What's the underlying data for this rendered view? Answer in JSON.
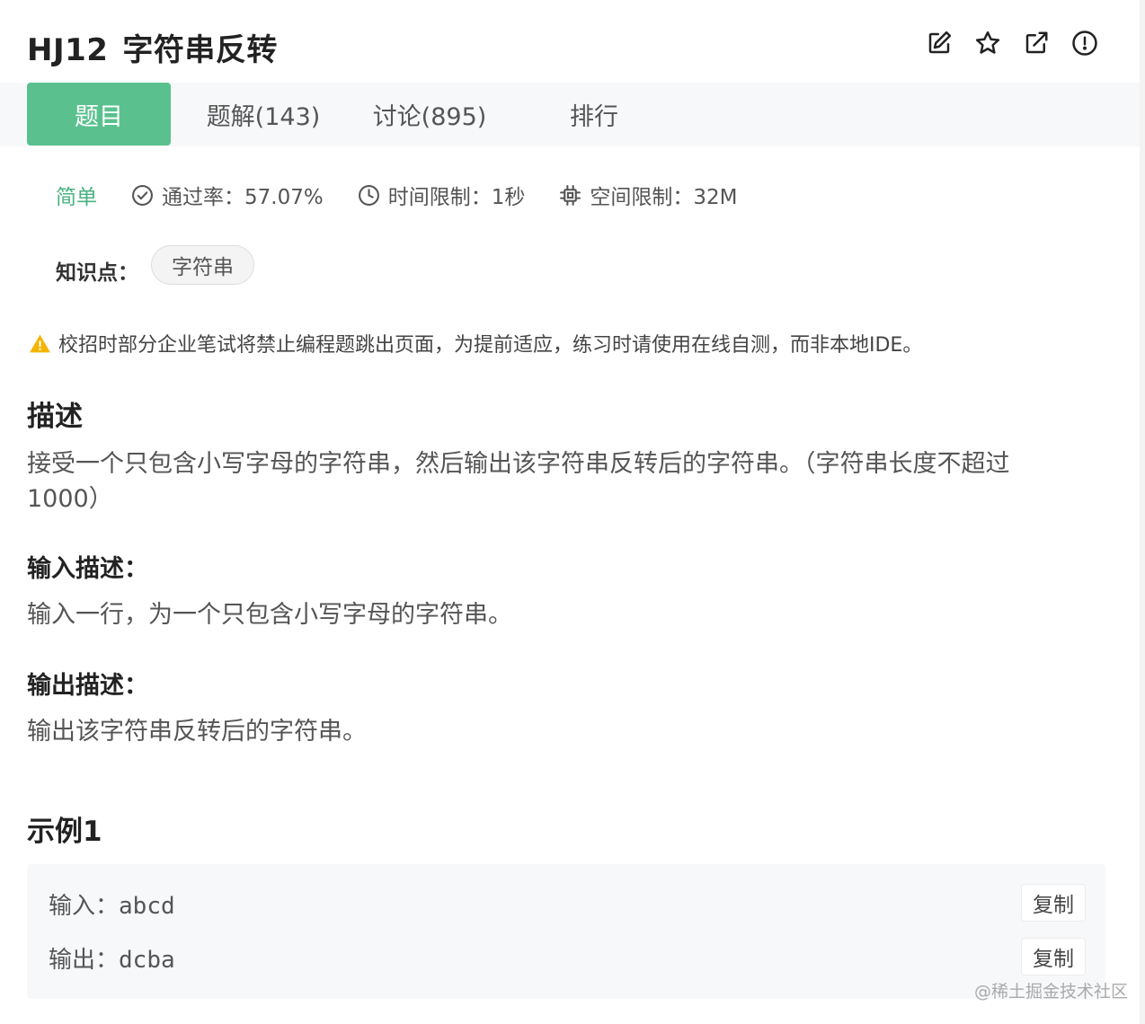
{
  "header": {
    "problem_id": "HJ12",
    "problem_title": "字符串反转",
    "icons": [
      "edit-icon",
      "star-icon",
      "external-link-icon",
      "alert-circle-icon"
    ]
  },
  "tabs": [
    {
      "label": "题目",
      "active": true
    },
    {
      "label": "题解(143)",
      "active": false
    },
    {
      "label": "讨论(895)",
      "active": false
    },
    {
      "label": "排行",
      "active": false
    }
  ],
  "meta": {
    "difficulty": "简单",
    "pass_rate": "通过率：57.07%",
    "time_limit": "时间限制：1秒",
    "space_limit": "空间限制：32M"
  },
  "knowledge": {
    "label": "知识点：",
    "tags": [
      "字符串"
    ]
  },
  "warning": "校招时部分企业笔试将禁止编程题跳出页面，为提前适应，练习时请使用在线自测，而非本地IDE。",
  "description": {
    "heading": "描述",
    "text": "接受一个只包含小写字母的字符串，然后输出该字符串反转后的字符串。（字符串长度不超过1000）"
  },
  "input_desc": {
    "heading": "输入描述：",
    "text": "输入一行，为一个只包含小写字母的字符串。"
  },
  "output_desc": {
    "heading": "输出描述：",
    "text": "输出该字符串反转后的字符串。"
  },
  "example": {
    "heading": "示例1",
    "input_label": "输入：",
    "input_value": "abcd",
    "output_label": "输出：",
    "output_value": "dcba",
    "copy_label": "复制"
  },
  "watermark": "@稀土掘金技术社区",
  "colors": {
    "accent": "#5ac18e",
    "difficulty_green": "#49b27f",
    "warning_yellow": "#f5b400"
  }
}
